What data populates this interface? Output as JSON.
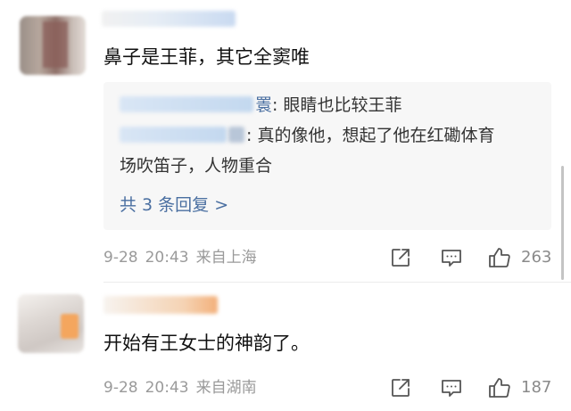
{
  "comments": [
    {
      "text": "鼻子是王菲，其它全窦唯",
      "replies": [
        {
          "name_suffix": "瞏",
          "text": ": 眼睛也比较王菲"
        },
        {
          "name_suffix": "",
          "text": ": 真的像他，想起了他在红磡体育",
          "text_cont": "场吹笛子，人物重合"
        }
      ],
      "more_replies_label": "共 3 条回复 >",
      "date": "9-28",
      "time": "20:43",
      "location": "来自上海",
      "like_count": "263"
    },
    {
      "text": "开始有王女士的神韵了。",
      "date": "9-28",
      "time": "20:43",
      "location": "来自湖南",
      "like_count": "187"
    }
  ],
  "icons": {
    "share": "share-icon",
    "comment": "comment-icon",
    "like": "like-icon"
  },
  "colors": {
    "link": "#4a6fa1",
    "meta": "#9a9a9a",
    "reply_bg": "#f7f7f7"
  }
}
